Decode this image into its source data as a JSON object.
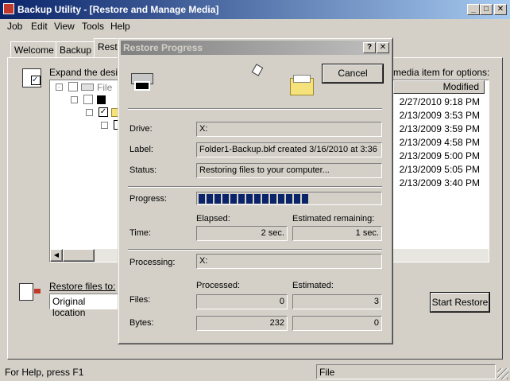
{
  "window": {
    "title": "Backup Utility - [Restore and Manage Media]"
  },
  "menu": [
    "Job",
    "Edit",
    "View",
    "Tools",
    "Help"
  ],
  "tabs": [
    "Welcome",
    "Backup",
    "Restore"
  ],
  "tree": {
    "instruction": "Expand the desired media item",
    "instruction_right": "media item for options:",
    "item_label": "File",
    "column_header": "Modified"
  },
  "modified": [
    "2/27/2010 9:18 PM",
    "2/13/2009 3:53 PM",
    "2/13/2009 3:59 PM",
    "2/13/2009 4:58 PM",
    "2/13/2009 5:00 PM",
    "2/13/2009 5:05 PM",
    "2/13/2009 3:40 PM"
  ],
  "restore_to": {
    "label": "Restore files to:",
    "value": "Original location"
  },
  "start_restore": "Start Restore",
  "statusbar": {
    "help": "For Help, press F1",
    "pane": "File"
  },
  "dialog": {
    "title": "Restore Progress",
    "cancel": "Cancel",
    "drive_label": "Drive:",
    "drive": "X:",
    "label_label": "Label:",
    "label": "Folder1-Backup.bkf created 3/16/2010 at 3:36",
    "status_label": "Status:",
    "status": "Restoring files to your computer...",
    "progress_label": "Progress:",
    "progress_fraction": 0.62,
    "elapsed_header": "Elapsed:",
    "remaining_header": "Estimated remaining:",
    "time_label": "Time:",
    "elapsed": "2 sec.",
    "remaining": "1 sec.",
    "processing_label": "Processing:",
    "processing": "X:",
    "processed_header": "Processed:",
    "estimated_header": "Estimated:",
    "files_label": "Files:",
    "files_processed": "0",
    "files_estimated": "3",
    "bytes_label": "Bytes:",
    "bytes_processed": "232",
    "bytes_estimated": "0"
  }
}
